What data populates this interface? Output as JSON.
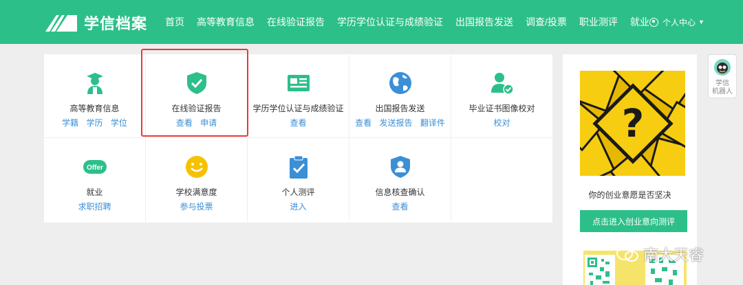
{
  "header": {
    "logo_text": "学信档案",
    "nav": [
      "首页",
      "高等教育信息",
      "在线验证报告",
      "学历学位认证与成绩验证",
      "出国报告发送",
      "调查/投票",
      "职业测评",
      "就业"
    ],
    "user_menu": "个人中心"
  },
  "services": [
    {
      "name": "高等教育信息",
      "links": [
        "学籍",
        "学历",
        "学位"
      ],
      "icon": "graduate-icon"
    },
    {
      "name": "在线验证报告",
      "links": [
        "查看",
        "申请"
      ],
      "icon": "shield-check-icon"
    },
    {
      "name": "学历学位认证与成绩验证",
      "links": [
        "查看"
      ],
      "icon": "id-card-icon"
    },
    {
      "name": "出国报告发送",
      "links": [
        "查看",
        "发送报告",
        "翻译件"
      ],
      "icon": "globe-icon"
    },
    {
      "name": "毕业证书图像校对",
      "links": [
        "校对"
      ],
      "icon": "user-check-icon"
    },
    {
      "name": "就业",
      "links": [
        "求职招聘"
      ],
      "icon": "offer-icon"
    },
    {
      "name": "学校满意度",
      "links": [
        "参与投票"
      ],
      "icon": "smile-icon"
    },
    {
      "name": "个人测评",
      "links": [
        "进入"
      ],
      "icon": "clipboard-check-icon"
    },
    {
      "name": "信息核查确认",
      "links": [
        "查看"
      ],
      "icon": "user-shield-icon"
    }
  ],
  "side": {
    "tagline": "你的创业意愿是否坚决",
    "button": "点击进入创业意向测评"
  },
  "robot": {
    "label_1": "学信",
    "label_2": "机器人"
  },
  "watermark": "南大天睿",
  "colors": {
    "brand": "#2dbf8a",
    "link": "#3b8fd6",
    "highlight": "#e53935"
  }
}
